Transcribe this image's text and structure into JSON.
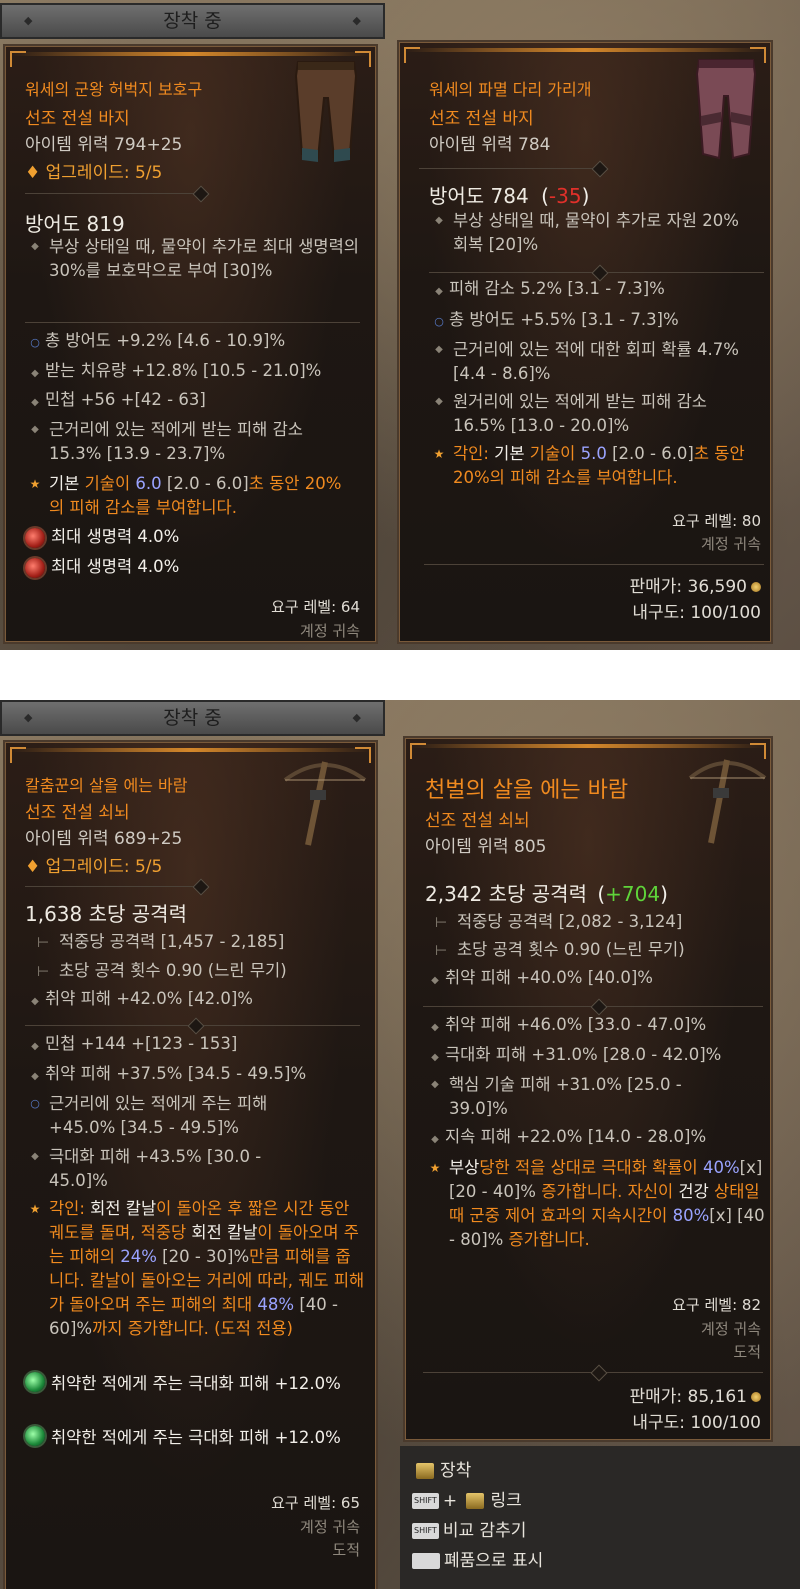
{
  "top": {
    "equipped_header": "장착 중",
    "left": {
      "name": "워세의 군왕 허벅지 보호구",
      "type": "선조 전설 바지",
      "item_power": "아이템 위력 794+25",
      "upgrade": "♦ 업그레이드: 5/5",
      "armor": "방어도 819",
      "implicit": "부상 상태일 때, 물약이 추가로 최대 생명력의 30%를 보호막으로 부여 [30]%",
      "affixes": [
        "총 방어도 +9.2% [4.6 - 10.9]%",
        "받는 치유량 +12.8% [10.5 - 21.0]%",
        "민첩 +56 +[42 - 63]",
        "근거리에 있는 적에게 받는 피해 감소 15.3% [13.9 - 23.7]%"
      ],
      "aspect": {
        "p1": "기본 ",
        "p2": "기술이 ",
        "val": "6.0",
        "p3": " [2.0 - 6.0]",
        "p4": "초 동안 20%의 피해 감소를 부여합니다."
      },
      "sockets": [
        "최대 생명력 4.0%",
        "최대 생명력 4.0%"
      ],
      "req_level": "요구 레벨: 64",
      "bound": "계정 귀속"
    },
    "right": {
      "name": "워세의 파멸 다리 가리개",
      "type": "선조 전설 바지",
      "item_power": "아이템 위력 784",
      "armor": "방어도 784",
      "armor_diff": "-35",
      "implicit": "부상 상태일 때, 물약이 추가로 자원 20% 회복 [20]%",
      "affixes": [
        "피해 감소 5.2% [3.1 - 7.3]%",
        "총 방어도 +5.5% [3.1 - 7.3]%",
        "근거리에 있는 적에 대한 회피 확률 4.7% [4.4 - 8.6]%",
        "원거리에 있는 적에게 받는 피해 감소 16.5% [13.0 - 20.0]%"
      ],
      "aspect": {
        "p0": "각인: ",
        "p1": "기본 ",
        "p2": "기술이 ",
        "val": "5.0",
        "p3": " [2.0 - 6.0]",
        "p4": "초 동안 20%의 피해 감소를 부여합니다."
      },
      "req_level": "요구 레벨: 80",
      "bound": "계정 귀속",
      "sell_price_label": "판매가: 36,590",
      "durability": "내구도: 100/100"
    }
  },
  "bottom": {
    "equipped_header": "장착 중",
    "left": {
      "name": "칼춤꾼의 살을 에는 바람",
      "type": "선조 전설 쇠뇌",
      "item_power": "아이템 위력 689+25",
      "upgrade": "♦ 업그레이드: 5/5",
      "dps": "1,638 초당 공격력",
      "sub1": "적중당 공격력 [1,457 - 2,185]",
      "sub2": "초당 공격 횟수 0.90 (느린 무기)",
      "implicit": "취약 피해 +42.0% [42.0]%",
      "affixes": [
        "민첩 +144 +[123 - 153]",
        "취약 피해 +37.5% [34.5 - 49.5]%",
        "근거리에 있는 적에게 주는 피해 +45.0% [34.5 - 49.5]%",
        "극대화 피해 +43.5% [30.0 - 45.0]%"
      ],
      "aspect": {
        "a": "각인: ",
        "b": "회전 칼날",
        "c": "이 돌아온 후 짧은 시간 동안 궤도를 돌며, 적중당 ",
        "d": "회전 칼날",
        "e": "이 돌아오며 주는 피해의 ",
        "f": "24%",
        "g": " [20 - 30]%",
        "h": "만큼 피해를 줍니다. 칼날이 돌아오는 거리에 따라, 궤도 피해가 돌아오며 주는 피해의 최대 ",
        "i": "48%",
        "j": " [40 - 60]%",
        "k": "까지 증가합니다. (도적 전용)"
      },
      "sockets": [
        "취약한 적에게 주는 극대화 피해 +12.0%",
        "취약한 적에게 주는 극대화 피해 +12.0%"
      ],
      "req_level": "요구 레벨: 65",
      "bound": "계정 귀속",
      "class": "도적"
    },
    "right": {
      "name": "천벌의 살을 에는 바람",
      "type": "선조 전설 쇠뇌",
      "item_power": "아이템 위력 805",
      "dps": "2,342 초당 공격력",
      "dps_diff": "+704",
      "sub1": "적중당 공격력 [2,082 - 3,124]",
      "sub2": "초당 공격 횟수 0.90 (느린 무기)",
      "implicit": "취약 피해 +40.0% [40.0]%",
      "affixes": [
        "취약 피해 +46.0% [33.0 - 47.0]%",
        "극대화 피해 +31.0% [28.0 - 42.0]%",
        "핵심 기술 피해 +31.0% [25.0 - 39.0]%",
        "지속 피해 +22.0% [14.0 - 28.0]%"
      ],
      "aspect": {
        "a": "부상",
        "b": "당한 적을 상대로 극대화 확률이 ",
        "c": "40%",
        "d": "[x] [20 - 40]%",
        "e": " 증가합니다. 자신이 ",
        "f": "건강",
        "g": " 상태일 때 군중 제어 효과의 지속시간이 ",
        "h": "80%",
        "i": "[x] [40 - 80]%",
        "j": " 증가합니다."
      },
      "req_level": "요구 레벨: 82",
      "bound": "계정 귀속",
      "class": "도적",
      "sell_price_label": "판매가: 85,161",
      "durability": "내구도: 100/100"
    },
    "hints": {
      "equip": "장착",
      "link_plus": "+",
      "link": "링크",
      "compare": "비교 감추기",
      "junk": "폐품으로 표시",
      "shift_key": "SHIFT"
    }
  },
  "colors": {
    "legendary": "#f08a1f",
    "diff_negative": "#e0302a",
    "diff_positive": "#5fd43a",
    "value_blue": "#9aa3ff"
  },
  "icons": [
    "diamond-bullet-icon",
    "circle-bullet-icon",
    "star-aspect-icon",
    "ruby-gem-icon",
    "emerald-gem-icon",
    "gold-coin-icon",
    "shift-key-icon",
    "mouse-button-icon"
  ]
}
